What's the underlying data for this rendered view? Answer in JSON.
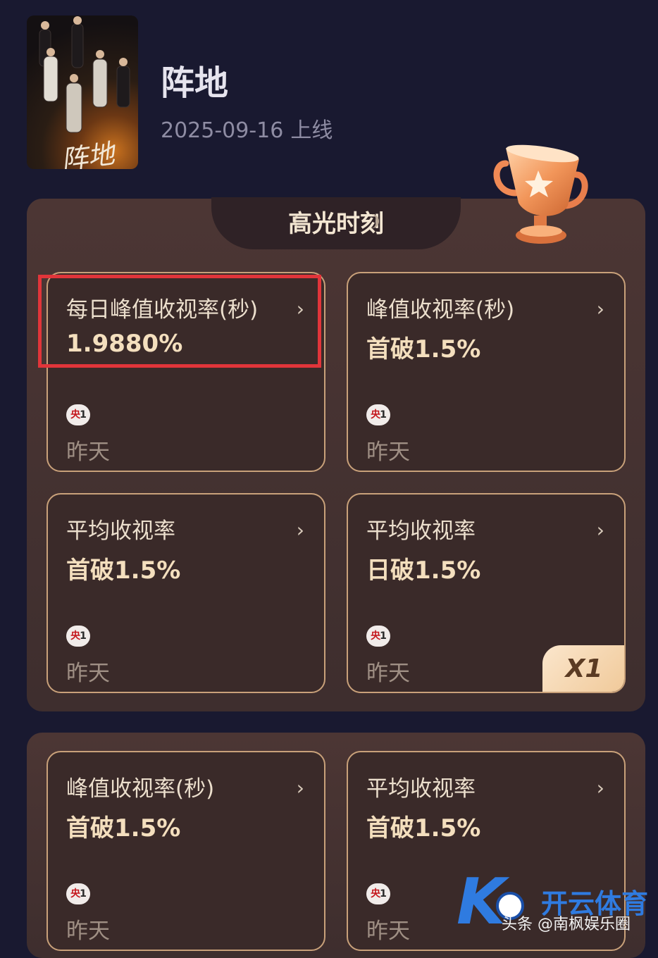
{
  "show": {
    "title": "阵地",
    "release_date": "2025-09-16",
    "release_suffix": "上线",
    "poster_text": "阵地"
  },
  "highlights": {
    "section_title": "高光时刻",
    "cards": [
      {
        "label": "每日峰值收视率(秒)",
        "value": "1.9880%",
        "channel": "央",
        "channel_num": "1",
        "when": "昨天"
      },
      {
        "label": "峰值收视率(秒)",
        "value": "首破1.5%",
        "channel": "央",
        "channel_num": "1",
        "when": "昨天"
      },
      {
        "label": "平均收视率",
        "value": "首破1.5%",
        "channel": "央",
        "channel_num": "1",
        "when": "昨天"
      },
      {
        "label": "平均收视率",
        "value": "日破1.5%",
        "channel": "央",
        "channel_num": "1",
        "when": "昨天",
        "multiplier": "X1"
      }
    ]
  },
  "lower_cards": [
    {
      "label": "峰值收视率(秒)",
      "value": "首破1.5%",
      "channel": "央",
      "channel_num": "1",
      "when": "昨天"
    },
    {
      "label": "平均收视率",
      "value": "首破1.5%",
      "channel": "央",
      "channel_num": "1",
      "when": "昨天"
    }
  ],
  "icons": {
    "chevron": "chevron-right-icon",
    "trophy": "trophy-icon",
    "laurel": "laurel-icon"
  },
  "watermark": {
    "brand": "开云体育",
    "source": "头条 @南枫娱乐圈"
  },
  "colors": {
    "background": "#191930",
    "panel": "#4c3634",
    "card_border": "#c9a17a",
    "highlight_box": "#e1353a",
    "value_text": "#f4dfbe"
  }
}
